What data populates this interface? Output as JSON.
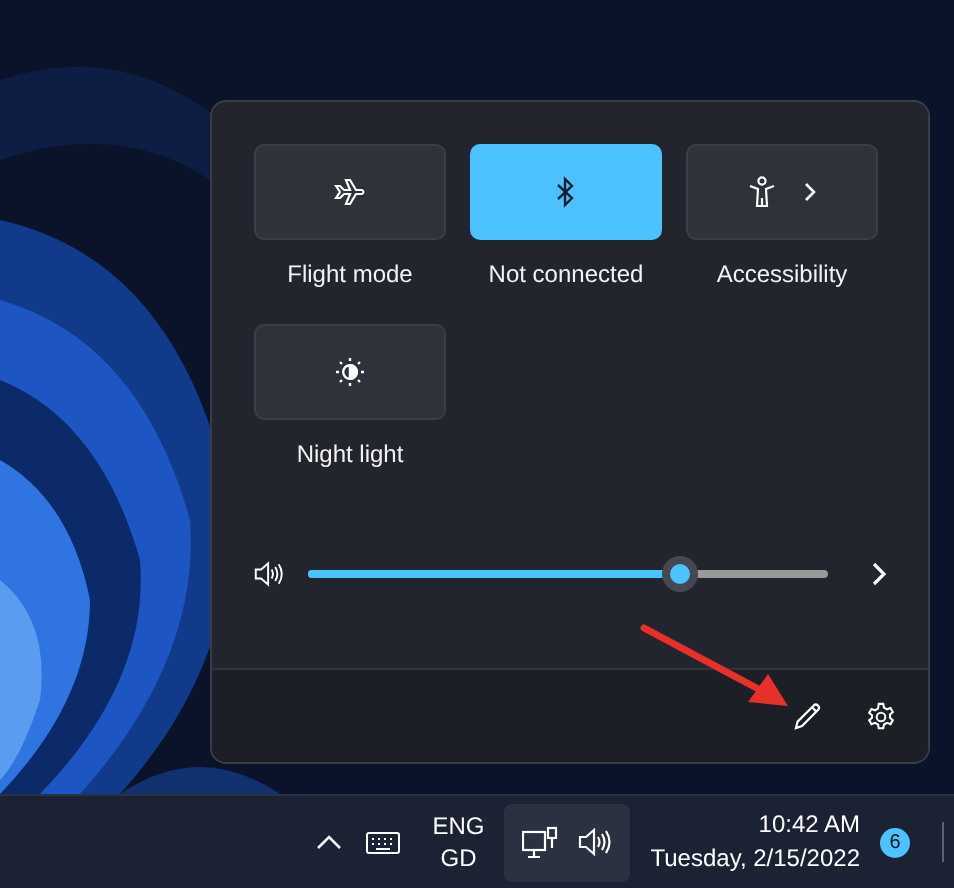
{
  "quick_settings": {
    "tiles": [
      {
        "kind": "flight",
        "label": "Flight mode",
        "on": false,
        "expandable": false
      },
      {
        "kind": "bluetooth",
        "label": "Not connected",
        "on": true,
        "expandable": false
      },
      {
        "kind": "accessibility",
        "label": "Accessibility",
        "on": false,
        "expandable": true
      },
      {
        "kind": "night_light",
        "label": "Night light",
        "on": false,
        "expandable": false
      }
    ],
    "volume": {
      "level": 0.715
    }
  },
  "taskbar": {
    "input_language": {
      "line_1": "ENG",
      "line_2": "GD"
    },
    "clock": {
      "time": "10:42 AM",
      "date": "Tuesday, 2/15/2022"
    },
    "notification_count": "6"
  }
}
